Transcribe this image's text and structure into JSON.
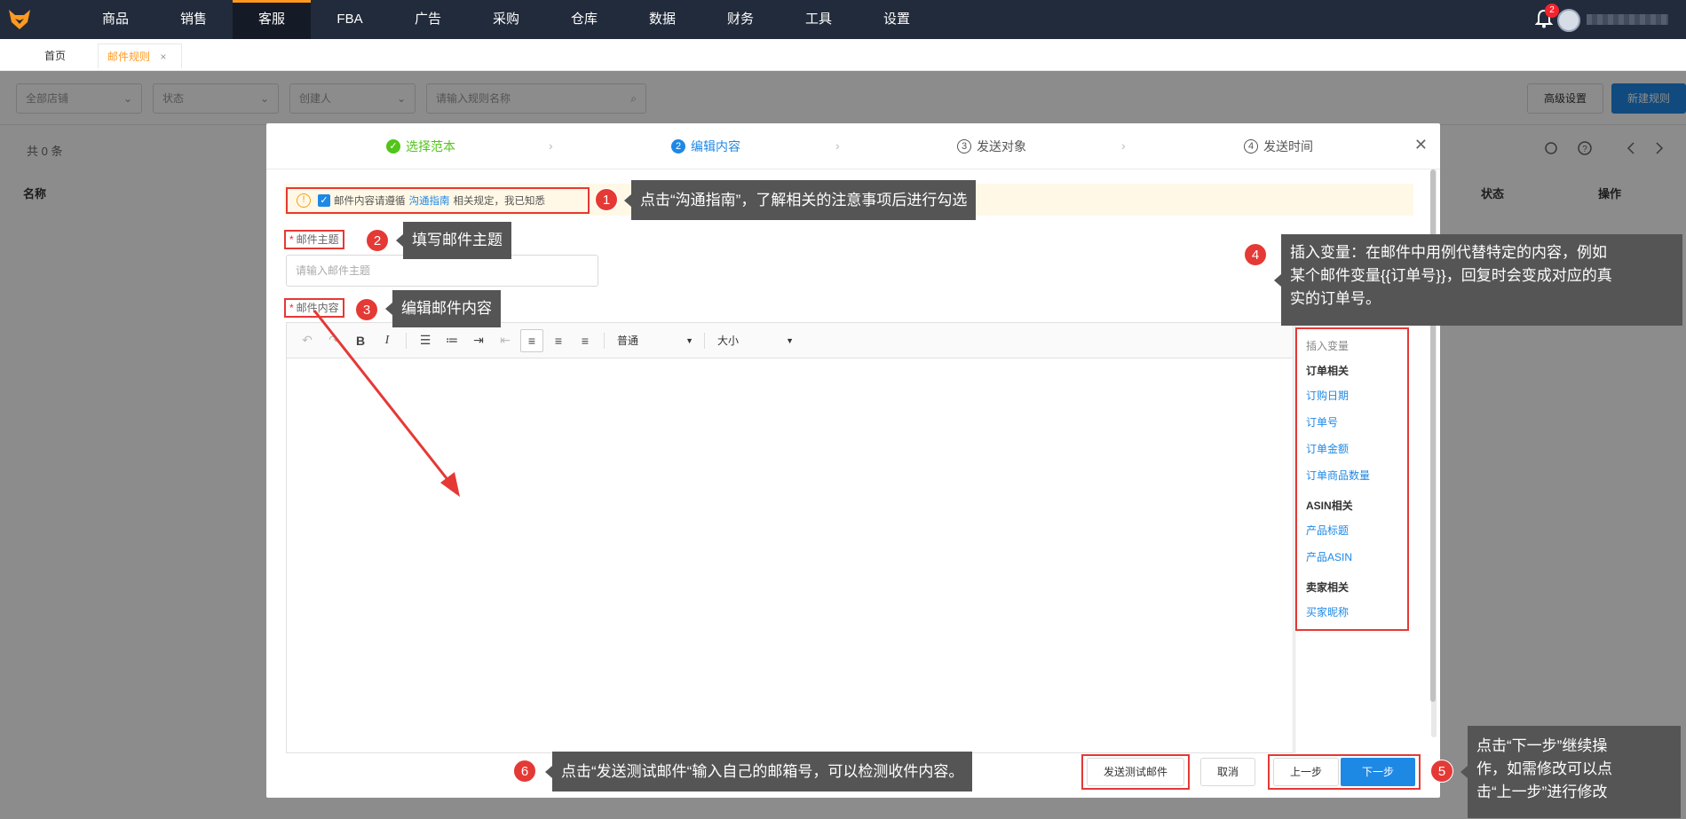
{
  "nav": {
    "items": [
      "商品",
      "销售",
      "客服",
      "FBA",
      "广告",
      "采购",
      "仓库",
      "数据",
      "财务",
      "工具",
      "设置"
    ],
    "active_index": 2,
    "notification_count": "2"
  },
  "tabs": {
    "home": "首页",
    "current": "邮件规则",
    "close_symbol": "×"
  },
  "background": {
    "filters": {
      "store": "全部店铺",
      "status": "状态",
      "creator": "创建人",
      "search_placeholder": "请输入规则名称"
    },
    "advanced_button": "高级设置",
    "new_rule_button": "新建规则",
    "count_text": "共 0 条",
    "columns": {
      "name": "名称",
      "status": "状态",
      "action": "操作"
    }
  },
  "modal": {
    "steps": [
      {
        "num": "✓",
        "label": "选择范本",
        "state": "done"
      },
      {
        "num": "2",
        "label": "编辑内容",
        "state": "active"
      },
      {
        "num": "3",
        "label": "发送对象",
        "state": "todo"
      },
      {
        "num": "4",
        "label": "发送时间",
        "state": "todo"
      }
    ],
    "notice": {
      "prefix": "邮件内容请遵循",
      "link": "沟通指南",
      "suffix": "相关规定，我已知悉",
      "checked": true
    },
    "subject": {
      "required_mark": "*",
      "label": "邮件主题",
      "placeholder": "请输入邮件主题"
    },
    "content": {
      "required_mark": "*",
      "label": "邮件内容"
    },
    "toolbar": {
      "style_select": "普通",
      "size_select": "大小"
    },
    "variables": {
      "title": "插入变量",
      "group_order": "订单相关",
      "order_items": [
        "订购日期",
        "订单号",
        "订单金额",
        "订单商品数量"
      ],
      "group_asin": "ASIN相关",
      "asin_items": [
        "产品标题",
        "产品ASIN"
      ],
      "group_buyer": "卖家相关",
      "buyer_items": [
        "买家昵称"
      ]
    },
    "buttons": {
      "send_test": "发送测试邮件",
      "cancel": "取消",
      "prev": "上一步",
      "next": "下一步"
    }
  },
  "callouts": {
    "c1": {
      "num": "1",
      "text": "点击“沟通指南”，了解相关的注意事项后进行勾选"
    },
    "c2": {
      "num": "2",
      "text": "填写邮件主题"
    },
    "c3": {
      "num": "3",
      "text": "编辑邮件内容"
    },
    "c4": {
      "num": "4",
      "line1": "插入变量：在邮件中用例代替特定的内容，例如",
      "line2": "某个邮件变量{{订单号}}，回复时会变成对应的真",
      "line3": "实的订单号。"
    },
    "c5": {
      "num": "5",
      "line1": "点击“下一步”继续操",
      "line2": "作，如需修改可以点",
      "line3": "击“上一步”进行修改"
    },
    "c6": {
      "num": "6",
      "text": "点击“发送测试邮件“输入自己的邮箱号，可以检测收件内容。"
    }
  },
  "colors": {
    "accent": "#1e88e5",
    "nav_bg": "#222b3b",
    "highlight_tab": "#ff9a1f",
    "callout_red": "#e53935",
    "success": "#52c41a"
  }
}
